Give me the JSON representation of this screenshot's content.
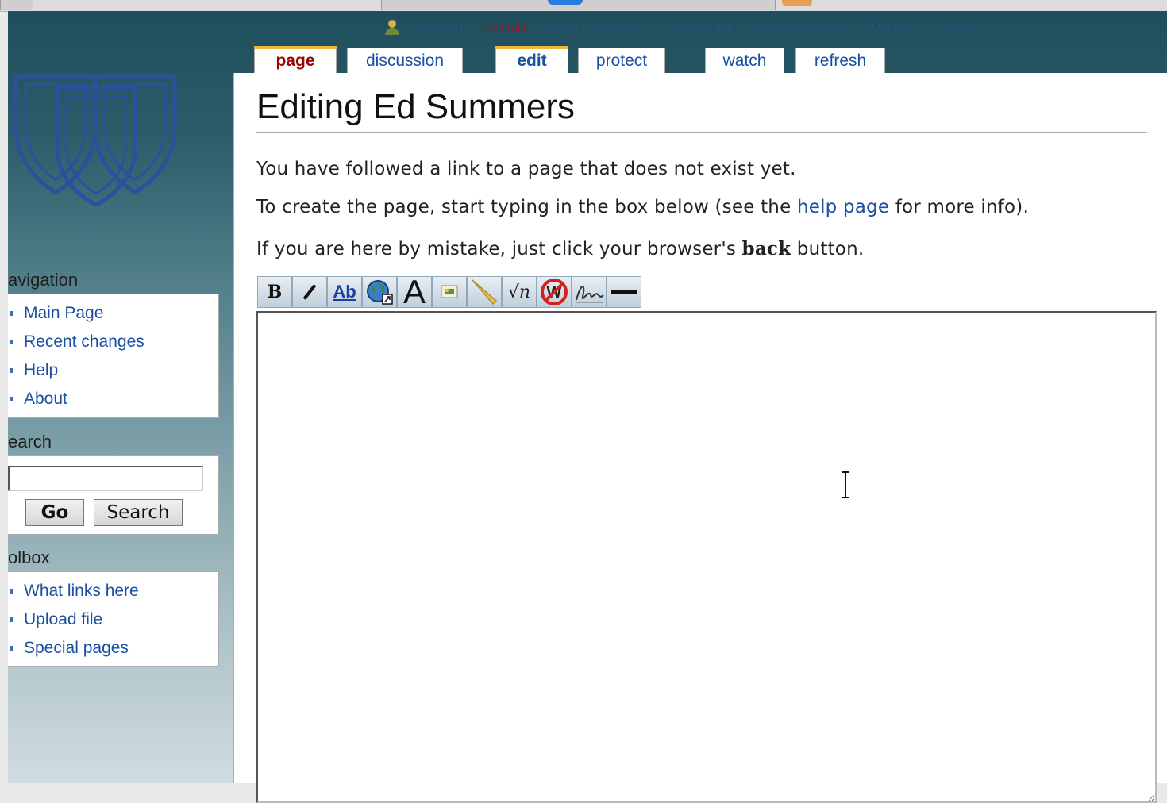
{
  "personal_bar": {
    "username": "Fcossing",
    "my_talk": "my talk",
    "my_preferences": "my preferences",
    "my_watchlist": "my watchlist",
    "my_contributions": "my contributions",
    "my_upload": "Upload",
    "log_out": "log out"
  },
  "tabs": {
    "page": "page",
    "discussion": "discussion",
    "edit": "edit",
    "protect": "protect",
    "watch": "watch",
    "refresh": "refresh"
  },
  "content": {
    "heading": "Editing Ed Summers",
    "p1": "You have followed a link to a page that does not exist yet.",
    "p2_before": "To create the page, start typing in the box below (see the ",
    "p2_link": "help page",
    "p2_after": " for more info).",
    "p3_before": "If you are here by mistake, just click your browser's ",
    "p3_bold": "back",
    "p3_after": " button.",
    "editor_value": ""
  },
  "toolbar": {
    "buttons": [
      {
        "name": "bold-button",
        "label": "B"
      },
      {
        "name": "italic-button",
        "label": "I"
      },
      {
        "name": "internal-link-button",
        "label": "Ab"
      },
      {
        "name": "external-link-button",
        "label": ""
      },
      {
        "name": "headline-button",
        "label": "A"
      },
      {
        "name": "embedded-image-button",
        "label": ""
      },
      {
        "name": "media-link-button",
        "label": ""
      },
      {
        "name": "math-formula-button",
        "label": "√n"
      },
      {
        "name": "nowiki-button",
        "label": "W"
      },
      {
        "name": "signature-button",
        "label": ""
      },
      {
        "name": "horizontal-line-button",
        "label": ""
      }
    ]
  },
  "sidebar": {
    "navigation_title": "avigation",
    "navigation_items": [
      "Main Page",
      "Recent changes",
      "Help",
      "About"
    ],
    "search_title": "earch",
    "search_value": "",
    "go_label": "Go",
    "search_label": "Search",
    "toolbox_title": "olbox",
    "toolbox_items": [
      "What links here",
      "Upload file",
      "Special pages"
    ]
  },
  "colors": {
    "link": "#1a4fa3",
    "new_link": "#a00000",
    "tab_selected_accent": "#f2b33b",
    "header_bg": "#1f4e5c"
  }
}
